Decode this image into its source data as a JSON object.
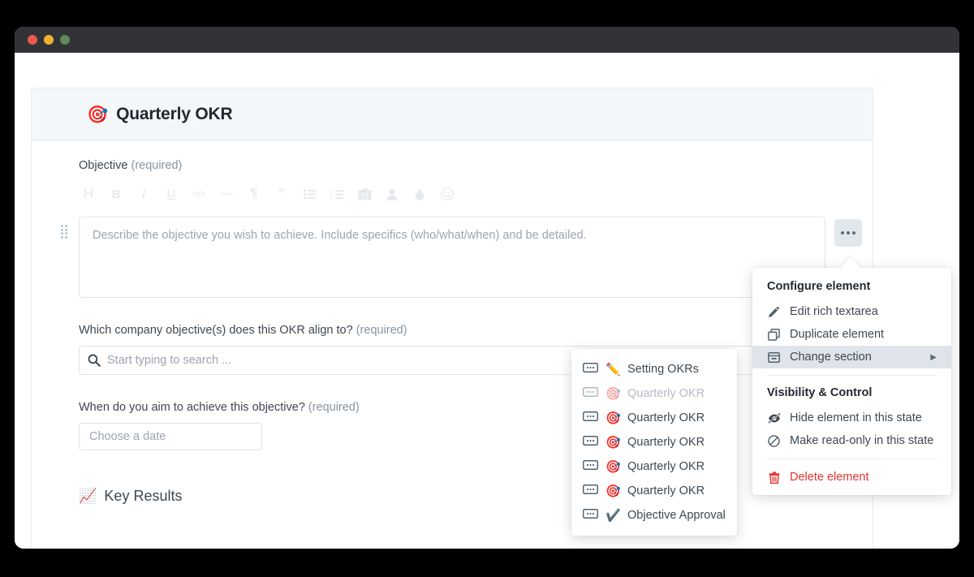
{
  "window": {
    "traffic_lights": [
      "close",
      "minimize",
      "maximize"
    ],
    "colors": {
      "close": "#e9594c",
      "minimize": "#f2b032",
      "maximize": "#5e8a5e",
      "titlebar": "#323336"
    }
  },
  "card": {
    "header": {
      "emoji": "🎯",
      "title": "Quarterly OKR",
      "background": "#f4f7fa"
    }
  },
  "fields": {
    "objective": {
      "label": "Objective",
      "required_text": "(required)",
      "placeholder": "Describe the objective you wish to achieve. Include specifics (who/what/when) and be detailed.",
      "value": ""
    },
    "align": {
      "label": "Which company objective(s) does this OKR align to?",
      "required_text": "(required)",
      "placeholder": "Start typing to search ...",
      "value": "",
      "icon": "search-icon"
    },
    "date": {
      "label": "When do you aim to achieve this objective?",
      "required_text": "(required)",
      "placeholder": "Choose a date",
      "value": ""
    }
  },
  "rte_toolbar": [
    {
      "name": "heading-icon",
      "glyph": "H"
    },
    {
      "name": "bold-icon",
      "glyph": "B"
    },
    {
      "name": "italic-icon",
      "glyph": "I"
    },
    {
      "name": "underline-icon",
      "glyph": "U"
    },
    {
      "name": "code-icon",
      "glyph": "</>"
    },
    {
      "name": "divider-icon",
      "glyph": "—"
    },
    {
      "name": "paragraph-icon",
      "glyph": "¶"
    },
    {
      "name": "blockquote-icon",
      "glyph": "❞"
    },
    {
      "name": "bullet-list-icon",
      "glyph": ""
    },
    {
      "name": "numbered-list-icon",
      "glyph": ""
    },
    {
      "name": "image-icon",
      "glyph": ""
    },
    {
      "name": "user-icon",
      "glyph": ""
    },
    {
      "name": "droplet-icon",
      "glyph": ""
    },
    {
      "name": "emoji-icon",
      "glyph": ""
    }
  ],
  "more_button": {
    "name": "more-options-button",
    "glyph": "•••"
  },
  "key_results": {
    "emoji": "📈",
    "label": "Key Results"
  },
  "context_menu": {
    "section_1_title": "Configure element",
    "items_1": [
      {
        "label": "Edit rich textarea",
        "icon": "pencil-icon",
        "selected": false
      },
      {
        "label": "Duplicate element",
        "icon": "duplicate-icon",
        "selected": false
      },
      {
        "label": "Change section",
        "icon": "section-icon",
        "selected": true,
        "has_submenu": true
      }
    ],
    "section_2_title": "Visibility & Control",
    "items_2": [
      {
        "label": "Hide element in this state",
        "icon": "eye-slash-icon"
      },
      {
        "label": "Make read-only in this state",
        "icon": "no-entry-icon"
      }
    ],
    "danger_item": {
      "label": "Delete element",
      "icon": "trash-icon",
      "color": "#e3342f"
    }
  },
  "submenu": {
    "items": [
      {
        "emoji": "✏️",
        "label": "Setting OKRs",
        "dim": false
      },
      {
        "emoji": "🎯",
        "label": "Quarterly OKR",
        "dim": true
      },
      {
        "emoji": "🎯",
        "label": "Quarterly OKR",
        "dim": false
      },
      {
        "emoji": "🎯",
        "label": "Quarterly OKR",
        "dim": false
      },
      {
        "emoji": "🎯",
        "label": "Quarterly OKR",
        "dim": false
      },
      {
        "emoji": "🎯",
        "label": "Quarterly OKR",
        "dim": false
      },
      {
        "emoji": "✔️",
        "label": "Objective Approval",
        "dim": false
      }
    ]
  }
}
